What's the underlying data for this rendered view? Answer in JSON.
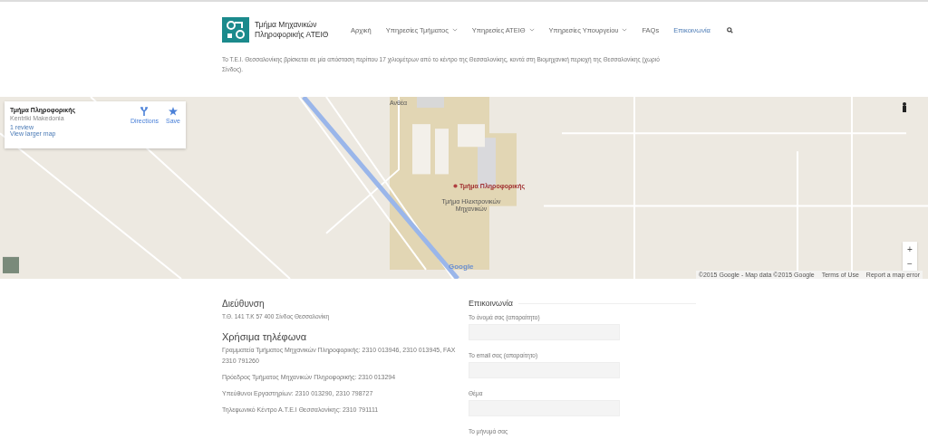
{
  "header": {
    "logo_text": "Τμήμα Μηχανικών Πληροφορικής ΑΤΕΙΘ",
    "nav": [
      {
        "label": "Αρχική",
        "dropdown": false,
        "selected": false
      },
      {
        "label": "Υπηρεσίες Τμήματος",
        "dropdown": true,
        "selected": false
      },
      {
        "label": "Υπηρεσίες ΑΤΕΙΘ",
        "dropdown": true,
        "selected": false
      },
      {
        "label": "Υπηρεσίες Υπουργείου",
        "dropdown": true,
        "selected": false
      },
      {
        "label": "FAQs",
        "dropdown": false,
        "selected": false
      },
      {
        "label": "Επικοινωνία",
        "dropdown": false,
        "selected": true
      }
    ]
  },
  "intro": "Το Τ.Ε.Ι. Θεσσαλονίκης βρίσκεται σε μία απόσταση περίπου 17 χιλιομέτρων από το κέντρο της Θεσσαλονίκης, κοντά στη Βιομηχανική περιοχή της Θεσσαλονίκης (χωριό Σίνδος).",
  "map": {
    "card": {
      "title": "Τμήμα Πληροφορικής",
      "subtitle": "Kentriki Makedonia",
      "reviews": "1 review",
      "larger_map": "View larger map",
      "directions": "Directions",
      "save": "Save"
    },
    "road_label": "Ανθέα",
    "place_label": "Τμήμα Πληροφορικής",
    "other_place_label": "Τμήμα Ηλεκτρονικών Μηχανικών",
    "google": "Google",
    "zoom_in": "+",
    "zoom_out": "−",
    "attribution": "©2015 Google - Map data ©2015 Google",
    "terms": "Terms of Use",
    "report": "Report a map error"
  },
  "address": {
    "heading": "Διεύθυνση",
    "text": "Τ.Θ. 141 Τ.Κ 57 400 Σίνδος Θεσσαλονίκη"
  },
  "phones": {
    "heading": "Χρήσιμα τηλέφωνα",
    "lines": [
      "Γραμματεία Τμήματος Μηχανικών Πληροφορικής: 2310 013946, 2310 013945, FAX 2310 791260",
      "Πρόεδρος Τμήματος Μηχανικών Πληροφορικής: 2310 013294",
      "Υπεύθυνοι Εργαστηρίων: 2310 013290, 2310 798727",
      "Τηλεφωνικό Κέντρο Α.Τ.Ε.Ι Θεσσαλονίκης: 2310 791111"
    ]
  },
  "contact": {
    "heading": "Επικοινωνία",
    "fields": [
      {
        "label": "Το όνομά σας (απαραίτητο)"
      },
      {
        "label": "Το email σας (απαραίτητο)"
      },
      {
        "label": "Θέμα"
      },
      {
        "label": "Το μήνυμά σας"
      }
    ]
  }
}
